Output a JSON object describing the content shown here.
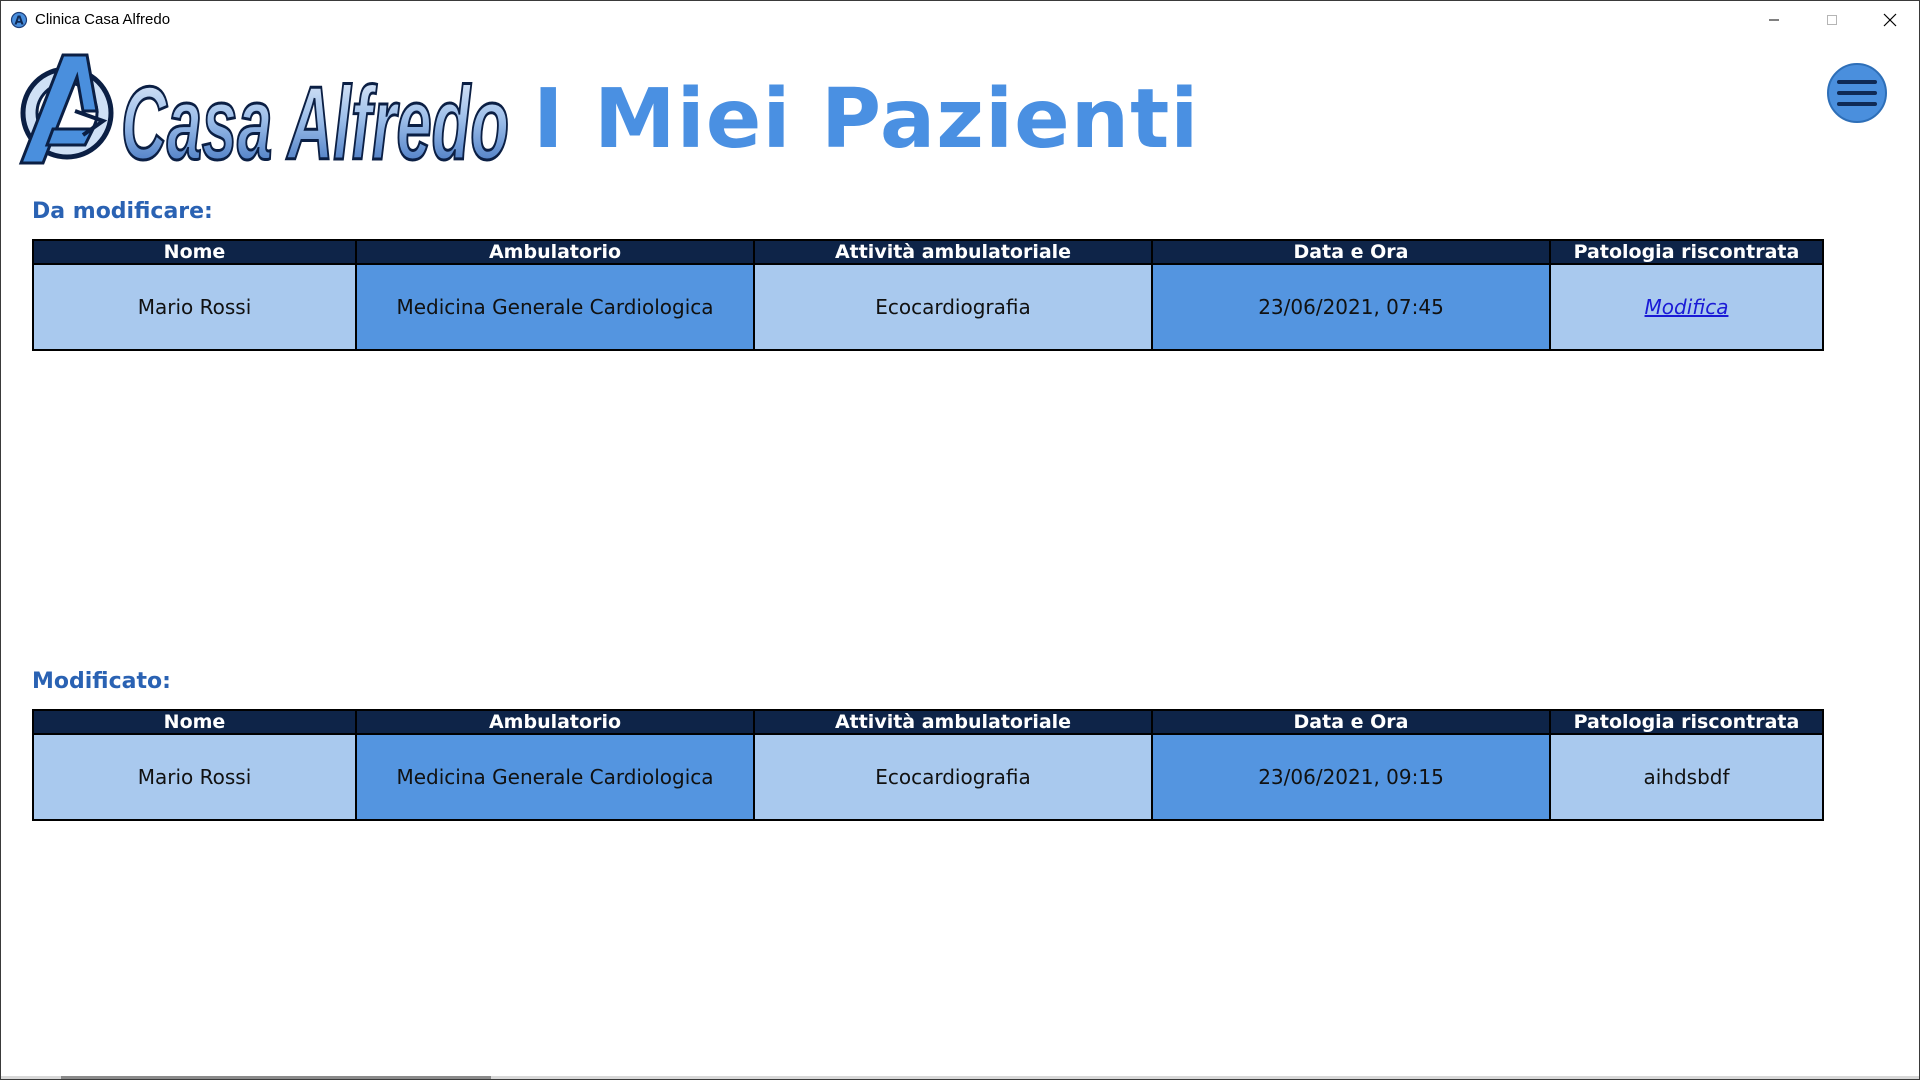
{
  "window": {
    "title": "Clinica Casa Alfredo"
  },
  "header": {
    "logo_text": "Casa Alfredo",
    "page_title": "I Miei Pazienti"
  },
  "columns": [
    "Nome",
    "Ambulatorio",
    "Attività ambulatoriale",
    "Data e Ora",
    "Patologia riscontrata"
  ],
  "to_modify": {
    "heading": "Da modificare:",
    "rows": [
      {
        "nome": "Mario Rossi",
        "ambulatorio": "Medicina Generale Cardiologica",
        "attivita": "Ecocardiografia",
        "data_ora": "23/06/2021, 07:45",
        "patologia": "Modifica"
      }
    ]
  },
  "modified": {
    "heading": "Modificato:",
    "rows": [
      {
        "nome": "Mario Rossi",
        "ambulatorio": "Medicina Generale Cardiologica",
        "attivita": "Ecocardiografia",
        "data_ora": "23/06/2021, 09:15",
        "patologia": "aihdsbdf"
      }
    ]
  },
  "icons": {
    "app": "app-logo-icon",
    "minimize": "minimize-icon",
    "maximize": "maximize-icon",
    "close": "close-icon",
    "menu": "hamburger-menu-icon"
  },
  "colors": {
    "title_blue": "#4a90e2",
    "heading_blue": "#2a62b3",
    "table_header": "#0e2448",
    "cell_light": "#a9c9ee",
    "cell_dark": "#5495e0",
    "link": "#1a1ad6"
  }
}
